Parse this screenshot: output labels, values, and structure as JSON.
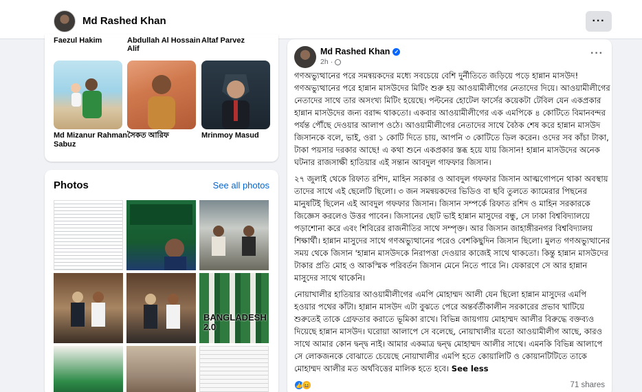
{
  "topbar": {
    "profile_name": "Md Rashed Khan",
    "more_label": "···"
  },
  "friends": {
    "top_names": [
      "Faezul Hakim",
      "Abdullah Al Hossain Alif",
      "Altaf Parvez"
    ],
    "items": [
      {
        "name": "Md Mizanur Rahman Sabuz"
      },
      {
        "name": "সৈকত আরিফ"
      },
      {
        "name": "Mrinmoy Masud"
      }
    ]
  },
  "photos": {
    "title": "Photos",
    "see_all": "See all photos",
    "overlay_texts": {
      "p6": "BANGLADESH 2.0"
    }
  },
  "post": {
    "author": "Md Rashed Khan",
    "time": "2h",
    "more_label": "···",
    "paragraphs": [
      "গণঅভ্যুত্থানের পরে সমন্বয়কদের মধ্যে সবচেয়ে বেশি দুর্নীতিতে জড়িয়ে পড়ে হান্নান মাসউদ! গণঅভ্যুত্থানের পরে হান্নান মাসউদের মিটিং শুরু হয় আওয়ামীলীগের নেতাদের দিয়ে। আওয়ামীলীগের নেতাদের সাথে তার অসংখ্য মিটিং হয়েছে। পল্টনের হোটেল ফার্সের কয়েকটা টেবিল যেন একপ্রকার হান্নান মাসউদের জন্য বরাদ্দ থাকতো। একবার আওয়ামীলীগের এক এমপিকে ৪ কোটিতে বিমানবন্দর পর্যন্ত পৌঁছে দেওয়ার আলাপ ওঠে। আওয়ামীলীগের নেতাদের সাথে বৈঠক শেষ করে হান্নান মাসউদ জিসানকে বলে, ভাই, ওরা ১ কোটি দিতে চায়, আপনি ৩ কোটিতে ডিল করেন। ওদের সব কাঁচা টাকা, টাকা পয়সার দরকার আছে! এ কথা শুনে একপ্রকার স্তব্ধ হয়ে যায় জিসান! হান্নান মাসউদের অনেক ঘটনার রাজসাক্ষী হাতিয়ার এই সন্তান আবদুল গাফফার জিসান।",
      "২৭ জুলাই থেকে রিফাত রশিদ, মাহিন সরকার ও আবদুল গফফার জিসান আত্মগোপনে থাকা অবস্থায় তাদের সাথে এই ছেলেটি ছিলো। ৩ জন সমন্বয়কদের ভিডিও বা ছবি তুলতে ক্যামেরার পিছনের মানুষটিই ছিলেন এই আবদুল গফফার জিসান। জিসান সম্পর্কে রিফাত রশিদ ও মাহিন সরকারকে জিজ্ঞেস করলেও উত্তর পাবেন। জিসানের ছোট ভাই হান্নান মাসুদের বন্ধু, সে ঢাকা বিশ্ববিদ্যালয়ে পড়াশোনা করে এবং শিবিরের রাজনীতির সাথে সম্পৃক্ত। আর জিসান জাহাঙ্গীরনগর বিশ্ববিদ্যালয় শিক্ষার্থী। হান্নান মাসুদের সাথে গণঅভ্যুত্থানের পরেও বেশকিছুদিন জিসান ছিলো। মুলত গণঅভ্যুত্থানের সময় থেকে জিসান 'হান্নান মাসউদকে নিরাপত্তা দেওয়ার কাজেই সাথে থাকতো। কিন্তু হান্নান মাসউদের টাকার প্রতি মোহ ও আকস্মিক পরিবর্তন জিসান মেনে নিতে পারে নি। যেকারণে সে আর হান্নান মাসুদের সাথে থাকেনি।",
      "নোয়াখালীর হাতিয়ার আওয়ামীলীগের এমপি মোহাম্মদ আলী যেন ছিলো হান্নান মাসুদের এমপি হওয়ার পথের কাঁটা। হান্নান মাসউদ এটা বুঝতে পেরে অন্তর্বর্তীকালীন সরকারের প্রভাব খাটিয়ে শুরুতেই তাকে গ্রেফতার করাতে ভূমিকা রাখে। বিভিন্ন জায়গায় মোহাম্মদ আলীর বিরুদ্ধে বক্তব্যও দিয়েছে হান্নান মাসউদ। ঘরোয়া আলাপে সে বলেছে, নোয়াখালীর যতো আওয়ামীলীগ আছে, কারও সাথে আমার কোন দ্বন্দ্ব নাই। আমার একমাত্র দ্বন্দ্ব মোহাম্মদ আলীর সাথে। এমনকি বিভিন্ন আলাপে সে লোকজনকে বোঝাতে চেয়েছে নোয়াখালীর এমপি হতে কোয়ালিটি ও কোয়ানটিটিতে তাকে মোহাম্মদ আলীর মত অর্থবিত্তের মালিক হতে হবে।"
    ],
    "see_less": "See less",
    "shares": "71 shares"
  },
  "colors": {
    "link": "#0064d1",
    "verified": "#0866ff",
    "page_bg": "#f0f2f5"
  }
}
